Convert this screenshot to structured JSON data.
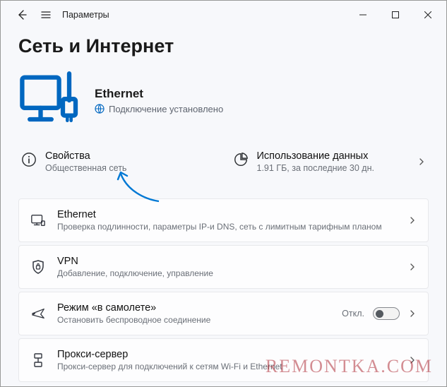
{
  "titlebar": {
    "label": "Параметры"
  },
  "page": {
    "heading": "Сеть и Интернет"
  },
  "hero": {
    "title": "Ethernet",
    "subtitle": "Подключение установлено"
  },
  "cards": {
    "properties": {
      "title": "Свойства",
      "subtitle": "Общественная сеть"
    },
    "usage": {
      "title": "Использование данных",
      "subtitle": "1.91 ГБ, за последние 30 дн."
    }
  },
  "rows": {
    "ethernet": {
      "title": "Ethernet",
      "subtitle": "Проверка подлинности, параметры IP-и DNS, сеть с лимитным тарифным планом"
    },
    "vpn": {
      "title": "VPN",
      "subtitle": "Добавление, подключение, управление"
    },
    "airplane": {
      "title": "Режим «в самолете»",
      "subtitle": "Остановить беспроводное соединение",
      "toggle_label": "Откл."
    },
    "proxy": {
      "title": "Прокси-сервер",
      "subtitle": "Прокси-сервер для подключений к сетям Wi-Fi и Ethernet"
    }
  },
  "watermark": "REMONTKA.COM"
}
